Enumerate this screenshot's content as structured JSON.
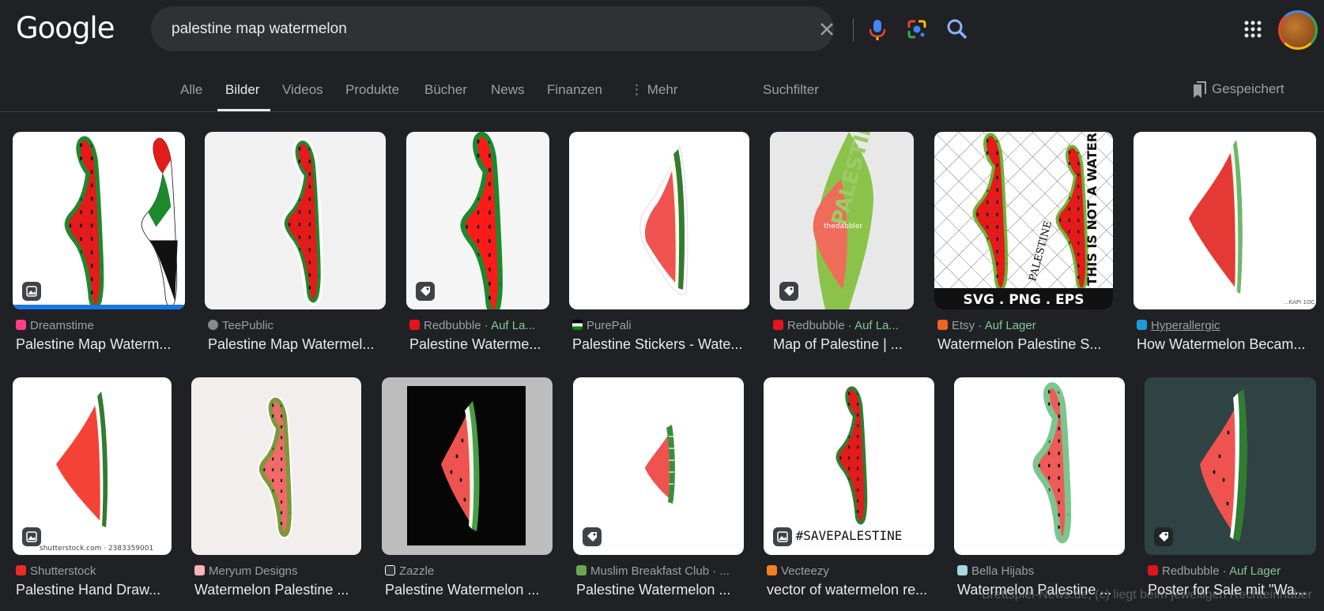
{
  "header": {
    "logo": "Google",
    "query": "palestine map watermelon"
  },
  "tabs": [
    {
      "label": "Alle"
    },
    {
      "label": "Bilder"
    },
    {
      "label": "Videos"
    },
    {
      "label": "Produkte"
    },
    {
      "label": "Bücher"
    },
    {
      "label": "News"
    },
    {
      "label": "Finanzen"
    },
    {
      "label": "⋮ Mehr"
    },
    {
      "label": "Suchfilter"
    }
  ],
  "saved_label": "Gespeichert",
  "results": [
    {
      "source": "Dreamstime",
      "stock": "",
      "title": "Palestine Map Waterm..."
    },
    {
      "source": "TeePublic",
      "stock": "",
      "title": "Palestine Map Watermel..."
    },
    {
      "source": "Redbubble",
      "stock": "· Auf La...",
      "title": "Palestine Waterme..."
    },
    {
      "source": "PurePali",
      "stock": "",
      "title": "Palestine Stickers - Wate..."
    },
    {
      "source": "Redbubble",
      "stock": "· Auf La...",
      "title": "Map of Palestine | ..."
    },
    {
      "source": "Etsy",
      "stock": "· Auf Lager",
      "title": "Watermelon Palestine S..."
    },
    {
      "source": "Hyperallergic",
      "stock": "",
      "title": "How Watermelon Becam..."
    },
    {
      "source": "Shutterstock",
      "stock": "",
      "title": "Palestine Hand Draw..."
    },
    {
      "source": "Meryum Designs",
      "stock": "",
      "title": "Watermelon Palestine ..."
    },
    {
      "source": "Zazzle",
      "stock": "",
      "title": "Palestine Watermelon ..."
    },
    {
      "source": "Muslim Breakfast Club · ...",
      "stock": "",
      "title": "Palestine Watermelon ..."
    },
    {
      "source": "Vecteezy",
      "stock": "",
      "title": "vector of watermelon re..."
    },
    {
      "source": "Bella Hijabs",
      "stock": "",
      "title": "Watermelon Palestine ..."
    },
    {
      "source": "Redbubble",
      "stock": "· Auf Lager",
      "title": "Poster for Sale mit \"Wa..."
    }
  ],
  "image_text": {
    "etsy_banner": "SVG . PNG . EPS",
    "etsy_slogan": "THIS IS NOT A WATERMELON",
    "etsy_word": "PALESTINE",
    "shutterstock_id": "shutterstock.com · 2383359001",
    "vecteezy_tag": "#SAVEPALESTINE",
    "dabbler_word": "PALESTINE",
    "dabbler_mark": "thedabbler",
    "hyper_sig": "...KAPI 1OC"
  },
  "footer_watermark": "Brettspiel-News.de, (c) liegt beim jeweiligen Rechteinhaber",
  "colors": {
    "accent_green": "#81c995",
    "link": "#8ab4f8",
    "bg": "#202124"
  }
}
